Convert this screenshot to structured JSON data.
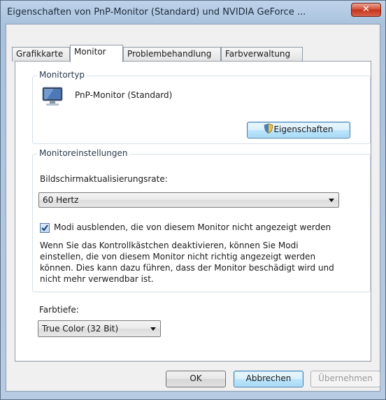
{
  "window": {
    "title": "Eigenschaften von PnP-Monitor (Standard) und NVIDIA GeForce ..."
  },
  "tabs": [
    "Grafikkarte",
    "Monitor",
    "Problembehandlung",
    "Farbverwaltung"
  ],
  "active_tab": "Monitor",
  "monitortyp": {
    "legend": "Monitortyp",
    "name": "PnP-Monitor (Standard)",
    "properties_button": "Eigenschaften"
  },
  "monitoreinstellungen": {
    "legend": "Monitoreinstellungen",
    "refresh_label": "Bildschirmaktualisierungsrate:",
    "refresh_value": "60 Hertz",
    "hide_modes_label": "Modi ausblenden, die von diesem Monitor nicht angezeigt werden",
    "hide_modes_checked": true,
    "warning_lines": [
      "Wenn Sie das Kontrollkästchen deaktivieren, können Sie Modi",
      "einstellen, die von diesem Monitor nicht richtig angezeigt werden",
      "können. Dies kann dazu führen, dass der Monitor beschädigt wird und",
      "nicht mehr verwendbar ist."
    ]
  },
  "farbtiefe": {
    "label": "Farbtiefe:",
    "value": "True Color (32 Bit)"
  },
  "buttons": {
    "ok": "OK",
    "cancel": "Abbrechen",
    "apply": "Übernehmen"
  },
  "icons": {
    "close": "close-icon",
    "monitor": "monitor-icon",
    "shield": "uac-shield-icon"
  }
}
